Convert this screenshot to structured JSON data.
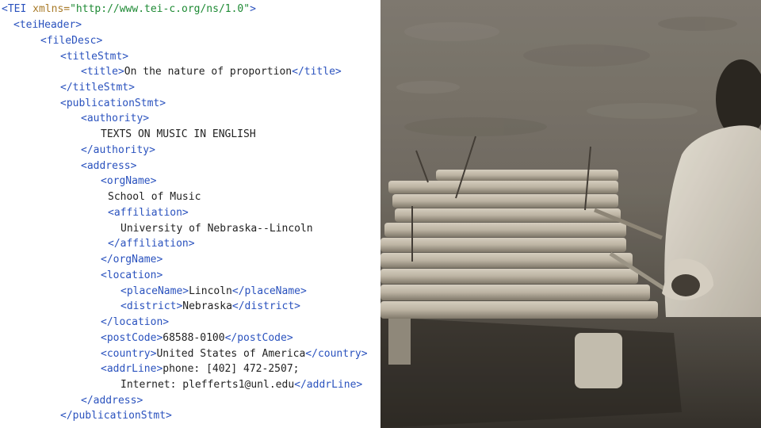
{
  "code": {
    "tei_open": "<TEI",
    "tei_attr": "xmlns=",
    "tei_ns": "\"http://www.tei-c.org/ns/1.0\"",
    "tei_close": ">",
    "teiHeader_open": "<teiHeader>",
    "fileDesc_open": "<fileDesc>",
    "titleStmt_open": "<titleStmt>",
    "title_open": "<title>",
    "title_text": "On the nature of proportion",
    "title_close": "</title>",
    "titleStmt_close": "</titleStmt>",
    "publicationStmt_open": "<publicationStmt>",
    "authority_open": "<authority>",
    "authority_text": "TEXTS ON MUSIC IN ENGLISH",
    "authority_close": "</authority>",
    "address_open": "<address>",
    "orgName_open": "<orgName>",
    "orgName_text": "School of Music",
    "affiliation_open": "<affiliation>",
    "affiliation_text": "University of Nebraska--Lincoln",
    "affiliation_close": "</affiliation>",
    "orgName_close": "</orgName>",
    "location_open": "<location>",
    "placeName_open": "<placeName>",
    "placeName_text": "Lincoln",
    "placeName_close": "</placeName>",
    "district_open": "<district>",
    "district_text": "Nebraska",
    "district_close": "</district>",
    "location_close": "</location>",
    "postCode_open": "<postCode>",
    "postCode_text": "68588-0100",
    "postCode_close": "</postCode>",
    "country_open": "<country>",
    "country_text": "United States of America",
    "country_close": "</country>",
    "addrLine_open": "<addrLine>",
    "addrLine_text1": "phone: [402] 472-2507;",
    "addrLine_text2": "Internet: plefferts1@unl.edu",
    "addrLine_close": "</addrLine>",
    "address_close": "</address>",
    "publicationStmt_close": "</publicationStmt>"
  },
  "colors": {
    "tag": "#2a52be",
    "attribute": "#a87a28",
    "value": "#1e8a34",
    "text": "#222222"
  },
  "photo": {
    "subject": "xylophone-photo"
  }
}
